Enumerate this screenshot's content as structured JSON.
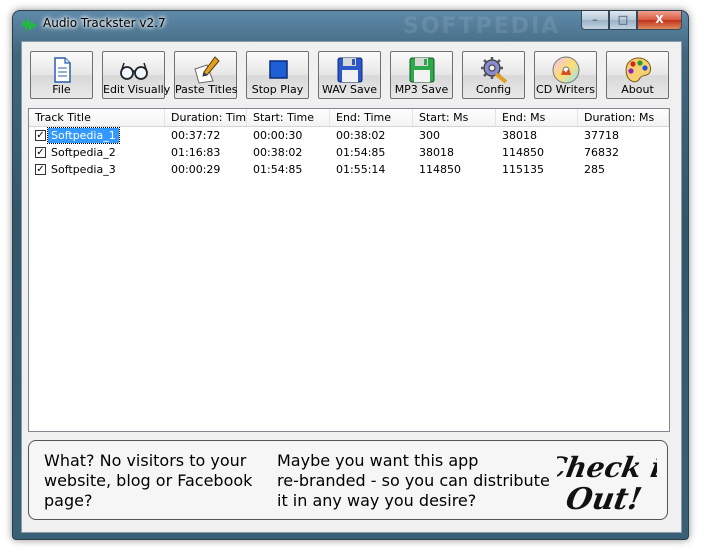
{
  "window": {
    "title": "Audio Trackster v2.7",
    "watermark": "SOFTPEDIA",
    "controls": {
      "minimize": "–",
      "maximize": "□",
      "close": "X"
    }
  },
  "toolbar": [
    {
      "label": "File",
      "icon": "file-icon"
    },
    {
      "label": "Edit Visually",
      "icon": "glasses-icon"
    },
    {
      "label": "Paste Titles",
      "icon": "pen-paper-icon"
    },
    {
      "label": "Stop Play",
      "icon": "stop-icon"
    },
    {
      "label": "WAV Save",
      "icon": "floppy-blue-icon"
    },
    {
      "label": "MP3 Save",
      "icon": "floppy-green-icon"
    },
    {
      "label": "Config",
      "icon": "gear-icon"
    },
    {
      "label": "CD Writers",
      "icon": "cd-icon"
    },
    {
      "label": "About",
      "icon": "palette-icon"
    }
  ],
  "table": {
    "columns": [
      "Track Title",
      "Duration: Time",
      "Start: Time",
      "End: Time",
      "Start: Ms",
      "End: Ms",
      "Duration: Ms"
    ],
    "rows": [
      {
        "title": "Softpedia_1",
        "checked": true,
        "selected": true,
        "duration_time": "00:37:72",
        "start_time": "00:00:30",
        "end_time": "00:38:02",
        "start_ms": "300",
        "end_ms": "38018",
        "duration_ms": "37718"
      },
      {
        "title": "Softpedia_2",
        "checked": true,
        "selected": false,
        "duration_time": "01:16:83",
        "start_time": "00:38:02",
        "end_time": "01:54:85",
        "start_ms": "38018",
        "end_ms": "114850",
        "duration_ms": "76832"
      },
      {
        "title": "Softpedia_3",
        "checked": true,
        "selected": false,
        "duration_time": "00:00:29",
        "start_time": "01:54:85",
        "end_time": "01:55:14",
        "start_ms": "114850",
        "end_ms": "115135",
        "duration_ms": "285"
      }
    ]
  },
  "banner": {
    "text_left": "What? No visitors to your\nwebsite, blog or Facebook\npage?",
    "text_right": "Maybe you want this app\nre-branded - so you can distribute\nit in any way you desire?",
    "cta_line1": "Check it",
    "cta_line2": "Out!"
  },
  "colors": {
    "selection": "#3399ff",
    "frame": "#41677f"
  }
}
